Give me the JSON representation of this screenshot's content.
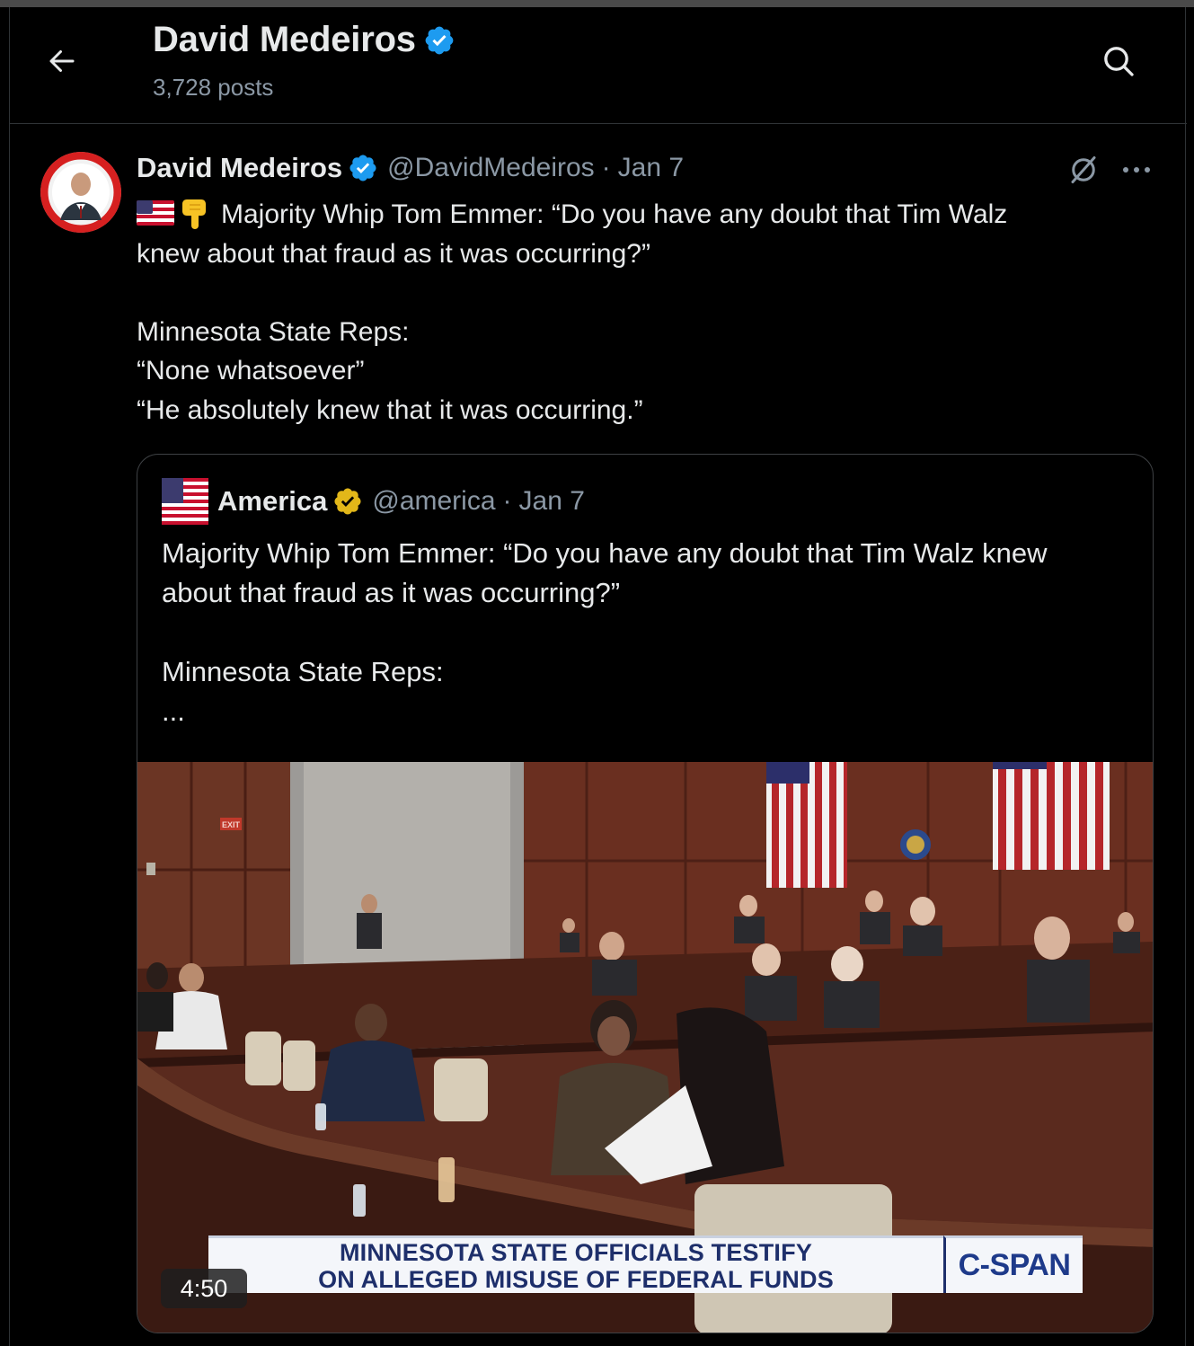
{
  "header": {
    "back_icon": "arrow-left-icon",
    "title": "David Medeiros",
    "verified_icon": "verified-badge-icon",
    "posts_count": "3,728 posts",
    "search_icon": "search-icon"
  },
  "post": {
    "author_name": "David Medeiros",
    "author_handle": "@DavidMedeiros",
    "separator": "·",
    "date": "Jan 7",
    "grok_icon": "grok-icon",
    "more_label": "···",
    "emojis": [
      "us-flag-emoji",
      "pointing-down-emoji"
    ],
    "text_lines": [
      "Majority Whip Tom Emmer: “Do you have any doubt that Tim Walz",
      "knew about that fraud as it was occurring?”",
      "",
      "Minnesota State Reps:",
      "“None whatsoever”",
      "“He absolutely knew that it was occurring.”"
    ]
  },
  "quote": {
    "avatar_icon": "us-flag-avatar",
    "author_name": "America",
    "verified_icon": "gold-verified-badge-icon",
    "author_handle": "@america",
    "separator": "·",
    "date": "Jan 7",
    "text_lines": [
      "Majority Whip Tom Emmer: “Do you have any doubt that Tim Walz knew",
      "about that fraud as it was occurring?”",
      "",
      "Minnesota State Reps:",
      "..."
    ],
    "video": {
      "chyron_line1": "MINNESOTA STATE OFFICIALS TESTIFY",
      "chyron_line2": "ON ALLEGED MISUSE OF FEDERAL FUNDS",
      "network": "C-SPAN",
      "exit_sign": "EXIT",
      "duration": "4:50"
    }
  },
  "colors": {
    "background": "#000000",
    "text": "#e7e9ea",
    "muted": "#8b98a5",
    "border": "#2f3336",
    "verified_blue": "#1d9bf0",
    "verified_gold": "#e2b719",
    "chyron_text": "#1e2f6b"
  }
}
